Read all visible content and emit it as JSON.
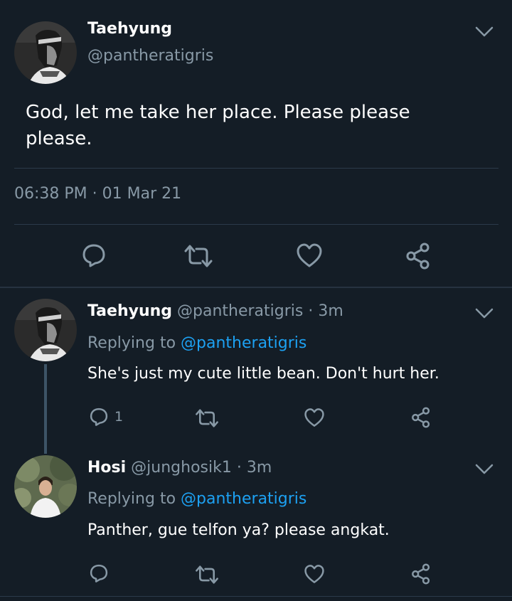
{
  "main_tweet": {
    "author_name": "Taehyung",
    "author_handle": "@pantheratigris",
    "text": "God, let me take her place. Please please please.",
    "timestamp": "06:38 PM · 01 Mar 21",
    "actions": [
      "reply-icon",
      "retweet-icon",
      "like-icon",
      "share-icon"
    ]
  },
  "replies": [
    {
      "author_name": "Taehyung",
      "author_handle": "@pantheratigris",
      "time": "· 3m",
      "replying_prefix": "Replying to",
      "replying_to": "@pantheratigris",
      "text": "She's just my cute little bean. Don't hurt her.",
      "reply_count": "1"
    },
    {
      "author_name": "Hosi",
      "author_handle": "@junghosik1",
      "time": "· 3m",
      "replying_prefix": "Replying to",
      "replying_to": "@pantheratigris",
      "text": "Panther, gue telfon ya? please angkat.",
      "reply_count": ""
    }
  ],
  "colors": {
    "background": "#141d26",
    "text": "#ffffff",
    "muted": "#8899a6",
    "link": "#1da1f2",
    "divider": "#2b3a4a"
  }
}
